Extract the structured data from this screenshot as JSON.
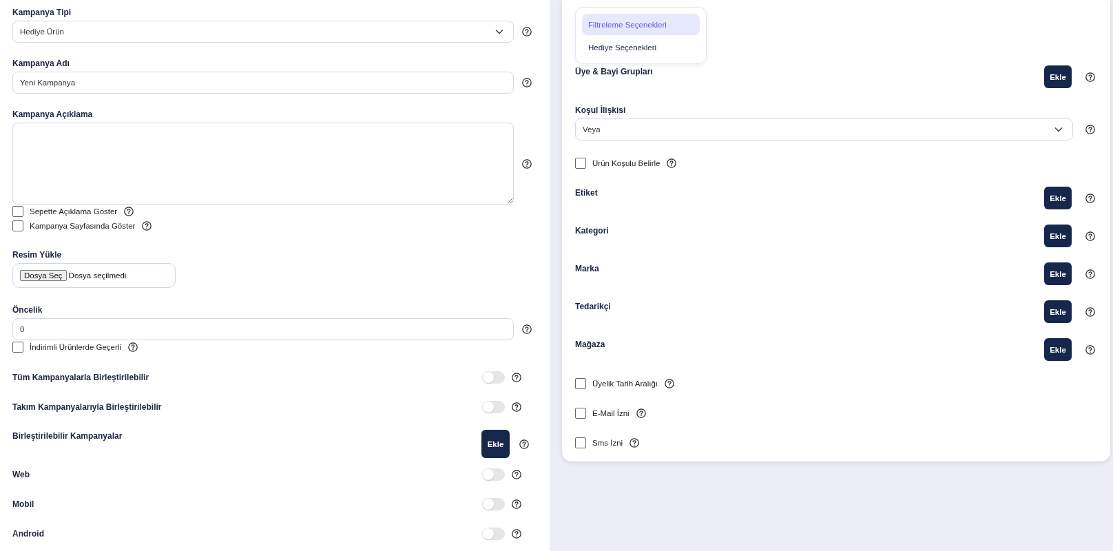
{
  "left": {
    "items": [
      {
        "kind": "select",
        "label": "Kampanya Tipi",
        "value": "Hediye Ürün"
      },
      {
        "kind": "input",
        "label": "Kampanya Adı",
        "value": "Yeni Kampanya"
      },
      {
        "kind": "textarea",
        "label": "Kampanya Açıklama",
        "value": ""
      },
      {
        "kind": "checkbox",
        "label": "Sepette Açıklama Göster",
        "checked": false
      },
      {
        "kind": "checkbox",
        "label": "Kampanya Sayfasında Göster",
        "checked": false
      },
      {
        "kind": "file",
        "label": "Resim Yükle",
        "button": "Dosya Seç",
        "status": "Dosya seçilmedi"
      },
      {
        "kind": "input",
        "label": "Öncelik",
        "value": "0"
      },
      {
        "kind": "checkbox",
        "label": "İndirimli Ürünlerde Geçerli",
        "checked": false
      },
      {
        "kind": "toggle",
        "label": "Tüm Kampanyalarla Birleştirilebilir",
        "on": false
      },
      {
        "kind": "toggle",
        "label": "Takım Kampanyalarıyla Birleştirilebilir",
        "on": false
      },
      {
        "kind": "add",
        "label": "Birleştirilebilir Kampanyalar",
        "button": "Ekle"
      },
      {
        "kind": "toggle",
        "label": "Web",
        "on": false
      },
      {
        "kind": "toggle",
        "label": "Mobil",
        "on": false
      },
      {
        "kind": "toggle",
        "label": "Android",
        "on": false
      }
    ]
  },
  "right": {
    "menu": [
      {
        "label": "Filtreleme Seçenekleri",
        "selected": true
      },
      {
        "label": "Hediye Seçenekleri",
        "selected": false
      }
    ],
    "items": [
      {
        "kind": "add",
        "label": "Üye & Bayi Grupları",
        "button": "Ekle"
      },
      {
        "kind": "select",
        "label": "Koşul İlişkisi",
        "value": "Veya"
      },
      {
        "kind": "checkbox",
        "label": "Ürün Koşulu Belirle",
        "checked": false
      },
      {
        "kind": "add",
        "label": "Etiket",
        "button": "Ekle"
      },
      {
        "kind": "add",
        "label": "Kategori",
        "button": "Ekle"
      },
      {
        "kind": "add",
        "label": "Marka",
        "button": "Ekle"
      },
      {
        "kind": "add",
        "label": "Tedarikçi",
        "button": "Ekle"
      },
      {
        "kind": "add",
        "label": "Mağaza",
        "button": "Ekle"
      },
      {
        "kind": "checkbox",
        "label": "Üyelik Tarih Aralığı",
        "checked": false
      },
      {
        "kind": "checkbox",
        "label": "E-Mail İzni",
        "checked": false
      },
      {
        "kind": "checkbox",
        "label": "Sms İzni",
        "checked": false
      }
    ]
  }
}
